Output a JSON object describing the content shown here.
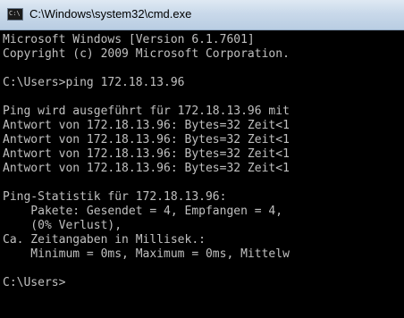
{
  "window": {
    "title": "C:\\Windows\\system32\\cmd.exe",
    "icon": "cmd-console-icon",
    "icon_text": "C:\\"
  },
  "console": {
    "lines": [
      "Microsoft Windows [Version 6.1.7601]",
      "Copyright (c) 2009 Microsoft Corporation.",
      "C:\\Users>ping 172.18.13.96",
      "Ping wird ausgeführt für 172.18.13.96 mit",
      "Antwort von 172.18.13.96: Bytes=32 Zeit<1",
      "Antwort von 172.18.13.96: Bytes=32 Zeit<1",
      "Antwort von 172.18.13.96: Bytes=32 Zeit<1",
      "Antwort von 172.18.13.96: Bytes=32 Zeit<1",
      "Ping-Statistik für 172.18.13.96:",
      "    Pakete: Gesendet = 4, Empfangen = 4,",
      "    (0% Verlust),",
      "Ca. Zeitangaben in Millisek.:",
      "    Minimum = 0ms, Maximum = 0ms, Mittelw",
      "C:\\Users>"
    ]
  },
  "colors": {
    "console_bg": "#000000",
    "console_text": "#c0c0c0",
    "titlebar": "#c9d9ea"
  }
}
